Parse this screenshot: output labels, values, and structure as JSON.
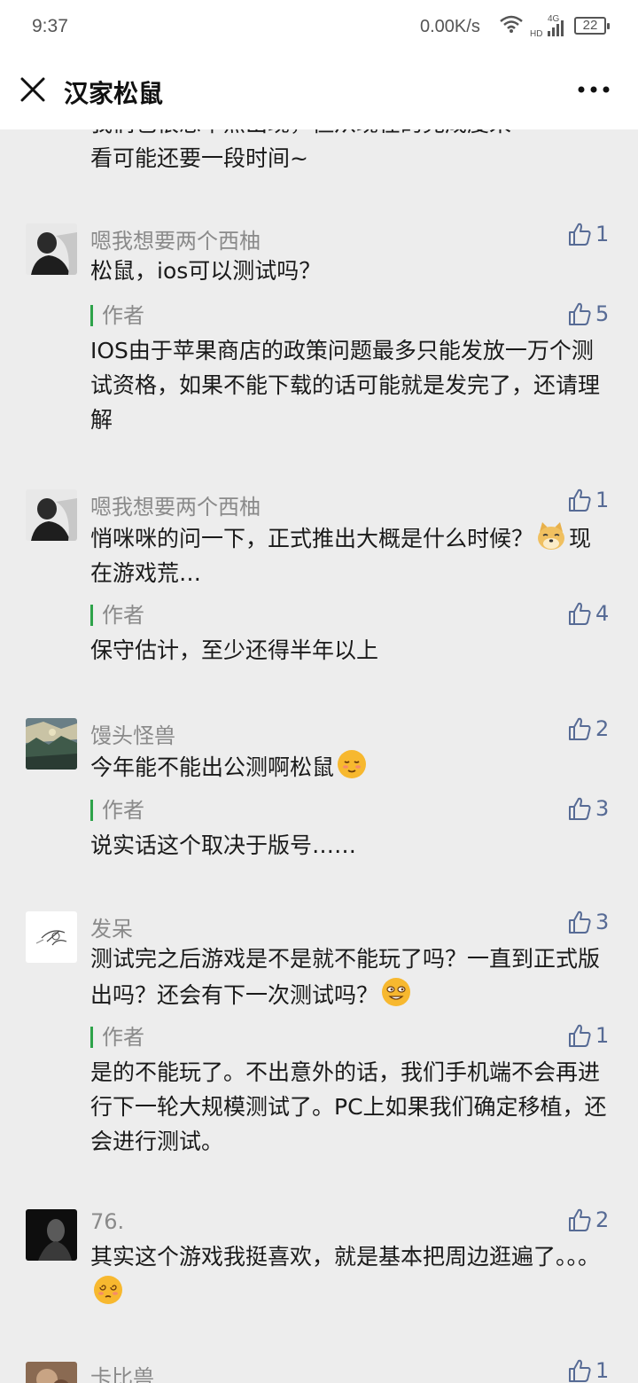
{
  "status_bar": {
    "time": "9:37",
    "network_speed": "0.00K/s",
    "signal_label_top": "4G",
    "signal_label_side": "HD",
    "battery": "22"
  },
  "nav": {
    "title": "汉家松鼠"
  },
  "top_partial": {
    "line1": "我们也很想早点出现，但从现在的完成度来",
    "line2": "看可能还要一段时间~"
  },
  "comments": [
    {
      "user": "嗯我想要两个西柚",
      "text": "松鼠，ios可以测试吗？",
      "likes": "1",
      "reply": {
        "tag": "作者",
        "text": "IOS由于苹果商店的政策问题最多只能发放一万个测试资格，如果不能下载的话可能就是发完了，还请理解",
        "likes": "5"
      }
    },
    {
      "user": "嗯我想要两个西柚",
      "text_before_emoji": "悄咪咪的问一下，正式推出大概是什么时候？",
      "text_after_emoji": "现在游戏荒…",
      "emoji": "doge-emoji",
      "likes": "1",
      "reply": {
        "tag": "作者",
        "text": "保守估计，至少还得半年以上",
        "likes": "4"
      }
    },
    {
      "user": "馒头怪兽",
      "text": "今年能不能出公测啊松鼠",
      "emoji": "relieved-face-emoji",
      "likes": "2",
      "reply": {
        "tag": "作者",
        "text": "说实话这个取决于版号……",
        "likes": "3"
      }
    },
    {
      "user": "发呆",
      "text": "测试完之后游戏是不是就不能玩了吗？一直到正式版出吗？还会有下一次测试吗？",
      "emoji": "smirk-face-emoji",
      "likes": "3",
      "reply": {
        "tag": "作者",
        "text": "是的不能玩了。不出意外的话，我们手机端不会再进行下一轮大规模测试了。PC上如果我们确定移植，还会进行测试。",
        "likes": "1"
      }
    },
    {
      "user": "76.",
      "text": "其实这个游戏我挺喜欢，就是基本把周边逛遍了。。。",
      "emoji": "dizzy-face-emoji",
      "likes": "2"
    },
    {
      "user": "卡比兽",
      "likes": "1"
    }
  ],
  "colors": {
    "background": "#ededed",
    "like_blue": "#576b95",
    "author_bar_green": "#2ea34a",
    "name_gray": "#8a8a8a"
  }
}
